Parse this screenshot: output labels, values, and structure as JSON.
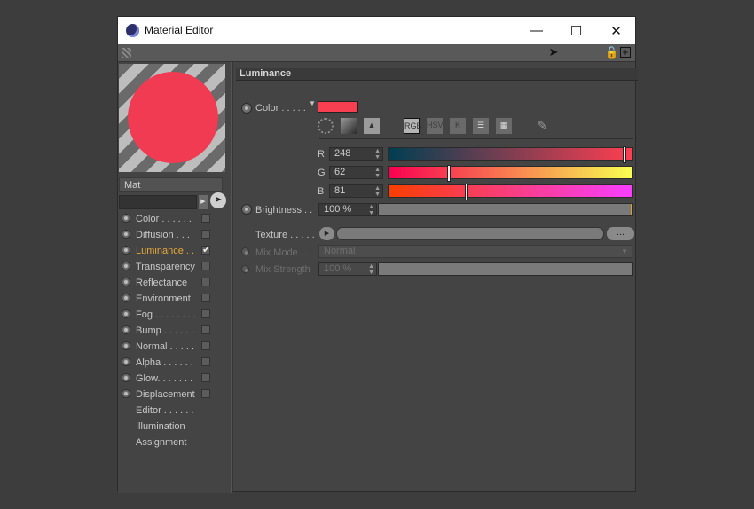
{
  "colors": {
    "background": "#3d3d3d",
    "luminance_color": "#f83e51",
    "accent_active": "#e7a93a"
  },
  "window": {
    "title": "Material Editor"
  },
  "material": {
    "name": "Mat"
  },
  "channels": [
    {
      "label": "Color . . . . . .",
      "radio": true,
      "checkbox": true,
      "checked": false,
      "active": false
    },
    {
      "label": "Diffusion . . .",
      "radio": true,
      "checkbox": true,
      "checked": false,
      "active": false
    },
    {
      "label": "Luminance . .",
      "radio": true,
      "checkbox": true,
      "checked": true,
      "active": true
    },
    {
      "label": "Transparency",
      "radio": true,
      "checkbox": true,
      "checked": false,
      "active": false
    },
    {
      "label": "Reflectance",
      "radio": true,
      "checkbox": true,
      "checked": false,
      "active": false
    },
    {
      "label": "Environment",
      "radio": true,
      "checkbox": true,
      "checked": false,
      "active": false
    },
    {
      "label": "Fog . . . . . . . .",
      "radio": true,
      "checkbox": true,
      "checked": false,
      "active": false
    },
    {
      "label": "Bump . . . . . .",
      "radio": true,
      "checkbox": true,
      "checked": false,
      "active": false
    },
    {
      "label": "Normal . . . . .",
      "radio": true,
      "checkbox": true,
      "checked": false,
      "active": false
    },
    {
      "label": "Alpha . . . . . .",
      "radio": true,
      "checkbox": true,
      "checked": false,
      "active": false
    },
    {
      "label": "Glow. . . . . . .",
      "radio": true,
      "checkbox": true,
      "checked": false,
      "active": false
    },
    {
      "label": "Displacement",
      "radio": true,
      "checkbox": true,
      "checked": false,
      "active": false
    },
    {
      "label": "Editor . . . . . .",
      "radio": false,
      "checkbox": false,
      "checked": false,
      "active": false
    },
    {
      "label": "Illumination",
      "radio": false,
      "checkbox": false,
      "checked": false,
      "active": false
    },
    {
      "label": "Assignment",
      "radio": false,
      "checkbox": false,
      "checked": false,
      "active": false
    }
  ],
  "section": {
    "title": "Luminance"
  },
  "color_param": {
    "label": "Color . . . . ."
  },
  "color_modes": {
    "rgb": "RGB",
    "hsv": "HSV",
    "k": "K"
  },
  "rgb": {
    "r": {
      "label": "R",
      "value": "248",
      "fraction": 0.973
    },
    "g": {
      "label": "G",
      "value": "62",
      "fraction": 0.243
    },
    "b": {
      "label": "B",
      "value": "81",
      "fraction": 0.318
    }
  },
  "brightness": {
    "label": "Brightness . .",
    "value": "100 %",
    "fraction": 1.0
  },
  "texture": {
    "label": "Texture . . . . .",
    "more_label": "..."
  },
  "mix_mode": {
    "label": "Mix Mode. . .",
    "value": "Normal"
  },
  "mix_strength": {
    "label": "Mix Strength",
    "value": "100 %"
  }
}
